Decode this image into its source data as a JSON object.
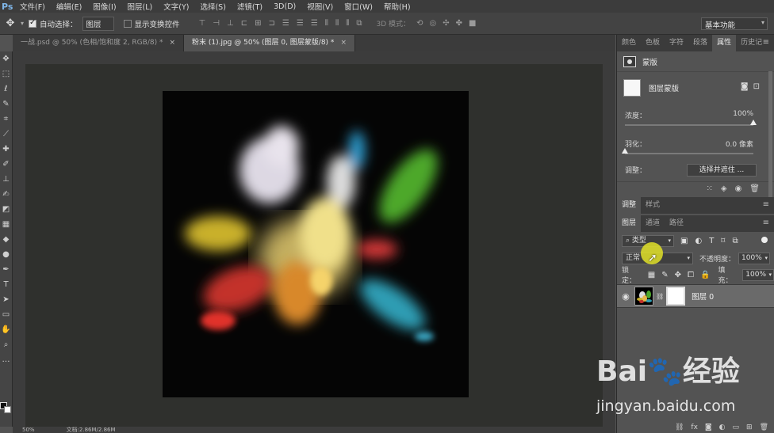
{
  "menubar": {
    "logo": "Ps",
    "items": [
      "文件(F)",
      "编辑(E)",
      "图像(I)",
      "图层(L)",
      "文字(Y)",
      "选择(S)",
      "滤镜(T)",
      "3D(D)",
      "视图(V)",
      "窗口(W)",
      "帮助(H)"
    ]
  },
  "options": {
    "auto_select_label": "自动选择：",
    "auto_select_target": "图层",
    "show_transform_label": "显示变换控件",
    "mode_3d_label": "3D 模式：",
    "workspace": "基本功能"
  },
  "tabs": [
    {
      "label": "一战.psd @ 50% (色相/饱和度 2, RGB/8) *",
      "active": false
    },
    {
      "label": "粉末 (1).jpg @ 50% (图层 0, 图层蒙版/8) *",
      "active": true
    }
  ],
  "status": {
    "zoom": "50%",
    "doc": "文档:2.86M/2.86M"
  },
  "properties_panel": {
    "tabs": [
      "颜色",
      "色板",
      "字符",
      "段落",
      "属性",
      "历史记"
    ],
    "active_tab": "属性",
    "title": "蒙版",
    "layer_mask_label": "图层蒙版",
    "density_label": "浓度：",
    "density_value": "100%",
    "density_level": 1.0,
    "feather_label": "羽化：",
    "feather_value": "0.0 像素",
    "feather_level": 0.0,
    "adjust_label": "调整：",
    "select_mask_button": "选择并遮住 ..."
  },
  "adjust_panel": {
    "tabs": [
      "调整",
      "样式"
    ]
  },
  "layers_panel": {
    "tabs": [
      "图层",
      "通道",
      "路径"
    ],
    "kind_label": "类型",
    "blend_mode": "正常",
    "opacity_label": "不透明度：",
    "opacity_value": "100%",
    "lock_label": "锁定：",
    "fill_label": "填充：",
    "fill_value": "100%",
    "layers": [
      {
        "name": "图层 0",
        "visible": true
      }
    ]
  },
  "watermark": {
    "brand": "Bai🐾经验",
    "url": "jingyan.baidu.com"
  },
  "colors": {
    "accent_highlight": "#e1e128",
    "panel_bg": "#535353",
    "canvas_bg": "#2f302d"
  }
}
